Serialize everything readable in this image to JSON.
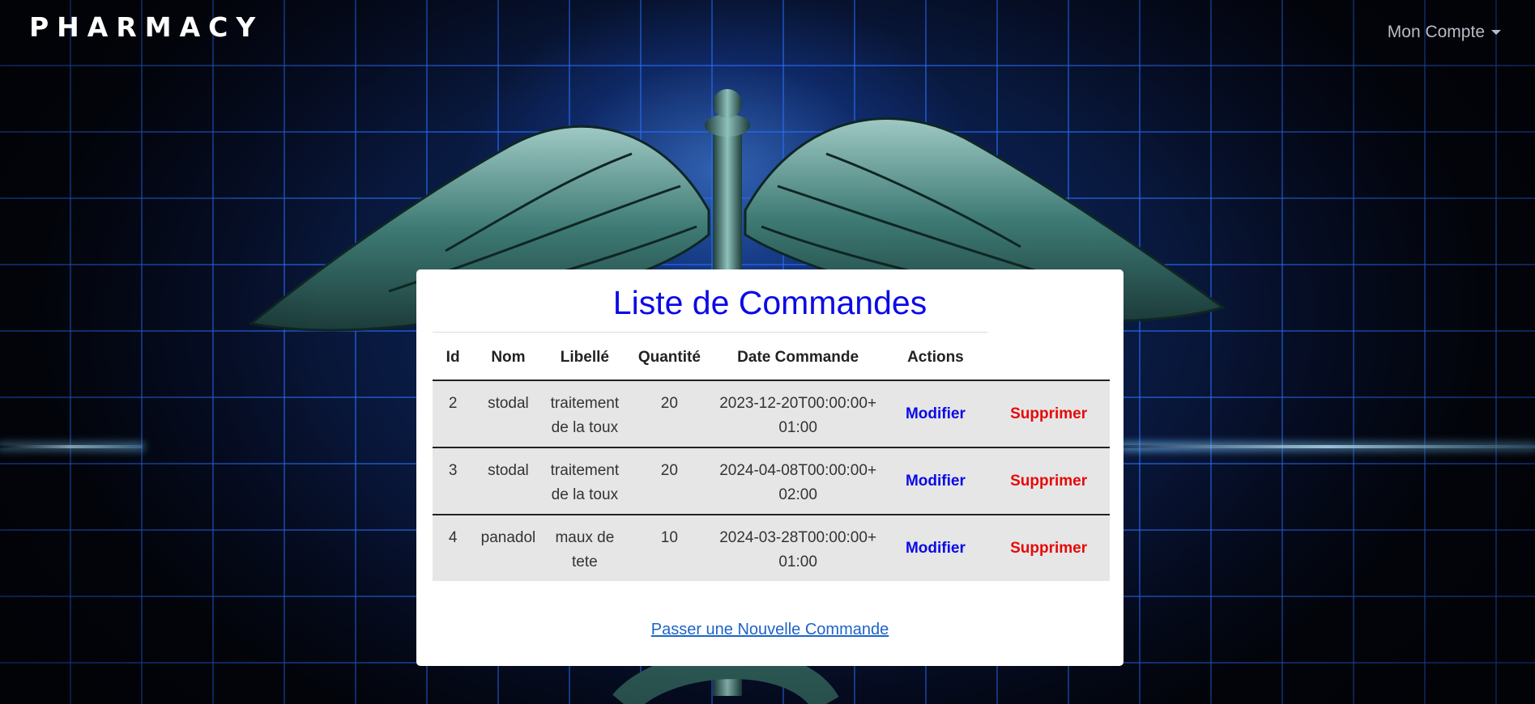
{
  "navbar": {
    "brand": "PHARMACY",
    "account_label": "Mon Compte"
  },
  "page": {
    "title": "Liste de Commandes",
    "new_order_link": "Passer une Nouvelle Commande"
  },
  "table": {
    "headers": [
      "Id",
      "Nom",
      "Libellé",
      "Quantité",
      "Date Commande",
      "Actions"
    ],
    "rows": [
      {
        "id": "2",
        "nom": "stodal",
        "libelle": "traitement de la toux",
        "quantite": "20",
        "date": "2023-12-20T00:00:00+01:00",
        "modify": "Modifier",
        "delete": "Supprimer"
      },
      {
        "id": "3",
        "nom": "stodal",
        "libelle": "traitement de la toux",
        "quantite": "20",
        "date": "2024-04-08T00:00:00+02:00",
        "modify": "Modifier",
        "delete": "Supprimer"
      },
      {
        "id": "4",
        "nom": "panadol",
        "libelle": "maux de tete",
        "quantite": "10",
        "date": "2024-03-28T00:00:00+01:00",
        "modify": "Modifier",
        "delete": "Supprimer"
      }
    ]
  },
  "colors": {
    "title": "#0a0ae6",
    "modify": "#0a0ae6",
    "delete": "#e60a0a",
    "link": "#1d64c8"
  }
}
